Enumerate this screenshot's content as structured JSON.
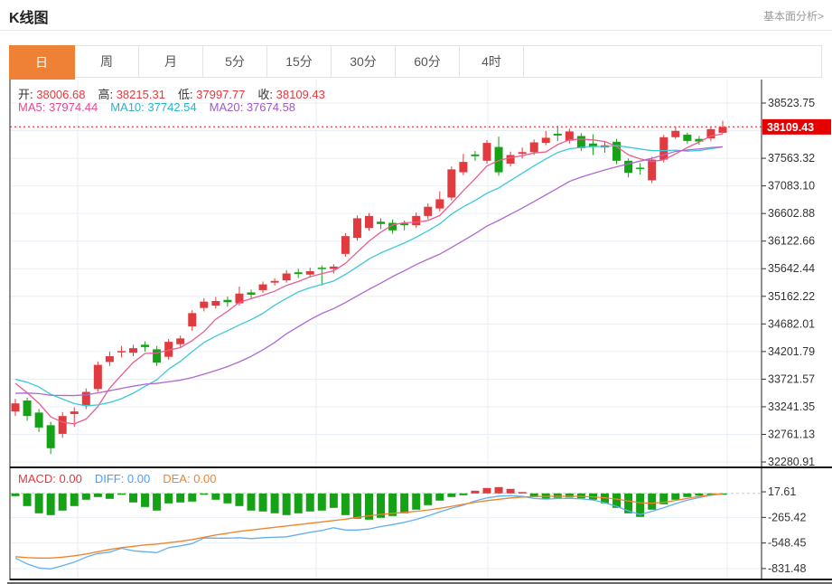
{
  "header": {
    "title": "K线图",
    "link": "基本面分析>"
  },
  "tabs": {
    "items": [
      {
        "label": "日",
        "active": true
      },
      {
        "label": "周",
        "active": false
      },
      {
        "label": "月",
        "active": false
      },
      {
        "label": "5分",
        "active": false
      },
      {
        "label": "15分",
        "active": false
      },
      {
        "label": "30分",
        "active": false
      },
      {
        "label": "60分",
        "active": false
      },
      {
        "label": "4时",
        "active": false
      }
    ]
  },
  "legend": {
    "ohlc": [
      {
        "label": "开:",
        "value": "38006.68"
      },
      {
        "label": "高:",
        "value": "38215.31"
      },
      {
        "label": "低:",
        "value": "37997.77"
      },
      {
        "label": "收:",
        "value": "38109.43"
      }
    ],
    "ma": [
      {
        "label": "MA5:",
        "value": "37974.44",
        "color": "#e8478f"
      },
      {
        "label": "MA10:",
        "value": "37742.54",
        "color": "#29b5c8"
      },
      {
        "label": "MA20:",
        "value": "37674.58",
        "color": "#a159c9"
      }
    ],
    "macd": [
      {
        "label": "MACD:",
        "value": "0.00",
        "color": "#e5383d"
      },
      {
        "label": "DIFF:",
        "value": "0.00",
        "color": "#4a9ff0"
      },
      {
        "label": "DEA:",
        "value": "0.00",
        "color": "#ef8330"
      }
    ]
  },
  "colors": {
    "up": "#e23b3f",
    "down": "#16a216",
    "ma5": "#ea5d8f",
    "ma10": "#3cc8dc",
    "ma20": "#b168cf",
    "diff": "#64aff0",
    "dea": "#f0842c",
    "badge": "#e60000",
    "tab_accent": "#ee8136",
    "price_line": "#f44f4f",
    "grid": "#e9eef6",
    "zero_dash": "#a4d6f0"
  },
  "chart_data": {
    "type": "candlestick",
    "title": "K线图",
    "legend_position": "top-left",
    "grid": true,
    "price_axis": {
      "top_tick": 38523.75,
      "tick_step": 480.215,
      "num_intervals": 13,
      "ticks": [
        "38523.75",
        "37563.32",
        "37083.10",
        "36602.88",
        "36122.66",
        "35642.44",
        "35162.22",
        "34682.01",
        "34201.79",
        "33721.57",
        "33241.35",
        "32761.13",
        "32280.91"
      ],
      "last_price": "38109.43",
      "last_price_value": 38109.43
    },
    "ohlc_today": {
      "open": 38006.68,
      "high": 38215.31,
      "low": 37997.77,
      "close": 38109.43
    },
    "ma_values": {
      "MA5": 37974.44,
      "MA10": 37742.54,
      "MA20": 37674.58
    },
    "candles": [
      [
        33160,
        33380,
        33080,
        33300
      ],
      [
        33350,
        33400,
        33000,
        33080
      ],
      [
        33140,
        33200,
        32800,
        32880
      ],
      [
        32920,
        32980,
        32420,
        32520
      ],
      [
        32770,
        33150,
        32700,
        33080
      ],
      [
        33115,
        33230,
        32890,
        33160
      ],
      [
        33270,
        33560,
        33200,
        33500
      ],
      [
        33550,
        34030,
        33500,
        33970
      ],
      [
        34020,
        34200,
        33950,
        34120
      ],
      [
        34200,
        34300,
        34100,
        34210
      ],
      [
        34180,
        34320,
        34120,
        34260
      ],
      [
        34320,
        34380,
        34200,
        34280
      ],
      [
        34240,
        34300,
        33950,
        34010
      ],
      [
        34110,
        34420,
        34060,
        34370
      ],
      [
        34330,
        34480,
        34280,
        34430
      ],
      [
        34640,
        34920,
        34560,
        34870
      ],
      [
        34960,
        35130,
        34900,
        35070
      ],
      [
        35000,
        35150,
        34950,
        35080
      ],
      [
        35100,
        35160,
        34980,
        35060
      ],
      [
        35040,
        35330,
        35000,
        35210
      ],
      [
        35230,
        35280,
        35120,
        35190
      ],
      [
        35270,
        35420,
        35220,
        35370
      ],
      [
        35400,
        35480,
        35350,
        35430
      ],
      [
        35440,
        35620,
        35400,
        35560
      ],
      [
        35580,
        35640,
        35480,
        35550
      ],
      [
        35540,
        35660,
        35490,
        35600
      ],
      [
        35660,
        35700,
        35350,
        35640
      ],
      [
        35640,
        35720,
        35560,
        35680
      ],
      [
        35900,
        36260,
        35850,
        36210
      ],
      [
        36180,
        36570,
        36130,
        36520
      ],
      [
        36350,
        36610,
        36300,
        36560
      ],
      [
        36460,
        36520,
        36330,
        36420
      ],
      [
        36440,
        36500,
        36250,
        36310
      ],
      [
        36430,
        36480,
        36310,
        36400
      ],
      [
        36400,
        36620,
        36350,
        36560
      ],
      [
        36560,
        36780,
        36500,
        36720
      ],
      [
        36690,
        36990,
        36640,
        36850
      ],
      [
        36880,
        37420,
        36830,
        37370
      ],
      [
        37320,
        37640,
        37270,
        37500
      ],
      [
        37630,
        37690,
        37520,
        37600
      ],
      [
        37520,
        37880,
        37470,
        37830
      ],
      [
        37760,
        37940,
        37260,
        37320
      ],
      [
        37470,
        37680,
        37420,
        37620
      ],
      [
        37640,
        37750,
        37560,
        37670
      ],
      [
        37670,
        37890,
        37620,
        37840
      ],
      [
        37830,
        38040,
        37790,
        37920
      ],
      [
        37990,
        38130,
        37860,
        37960
      ],
      [
        37870,
        38080,
        37820,
        38030
      ],
      [
        37950,
        38000,
        37690,
        37740
      ],
      [
        37820,
        37980,
        37620,
        37760
      ],
      [
        37750,
        37850,
        37660,
        37790
      ],
      [
        37850,
        37900,
        37460,
        37520
      ],
      [
        37520,
        37560,
        37230,
        37310
      ],
      [
        37400,
        37480,
        37280,
        37380
      ],
      [
        37180,
        37590,
        37130,
        37540
      ],
      [
        37540,
        37970,
        37490,
        37930
      ],
      [
        37930,
        38120,
        37900,
        38040
      ],
      [
        37975,
        38010,
        37820,
        37865
      ],
      [
        37900,
        37950,
        37800,
        37855
      ],
      [
        37910,
        38110,
        37860,
        38070
      ],
      [
        38006.68,
        38215.31,
        37997.77,
        38109.43
      ]
    ],
    "ma_windows": [
      5,
      10,
      20
    ],
    "ma_seed_closes": [
      33000,
      33050,
      33100,
      33150,
      33200,
      33250,
      33300,
      33350,
      33400,
      33500,
      33600,
      33700,
      33800,
      33900,
      33950,
      33900,
      33800,
      33700,
      33550
    ],
    "macd": {
      "ticks": [
        "17.61",
        "-265.42",
        "-548.45",
        "-831.48"
      ],
      "hist": [
        -30,
        -140,
        -220,
        -240,
        -190,
        -140,
        -70,
        -40,
        -60,
        -15,
        -100,
        -150,
        -190,
        -110,
        -100,
        -90,
        -15,
        -70,
        -110,
        -140,
        -190,
        -200,
        -220,
        -240,
        -220,
        -200,
        -190,
        -160,
        -240,
        -280,
        -290,
        -270,
        -250,
        -220,
        -180,
        -130,
        -80,
        -40,
        -20,
        30,
        60,
        70,
        50,
        15,
        -40,
        -60,
        -50,
        -45,
        -55,
        -70,
        -110,
        -160,
        -220,
        -260,
        -180,
        -120,
        -70,
        -40,
        -25,
        -12,
        -5
      ],
      "dea": [
        -700,
        -710,
        -715,
        -715,
        -705,
        -690,
        -670,
        -645,
        -620,
        -600,
        -585,
        -570,
        -560,
        -545,
        -530,
        -510,
        -485,
        -460,
        -440,
        -420,
        -405,
        -390,
        -375,
        -360,
        -345,
        -330,
        -315,
        -300,
        -285,
        -265,
        -248,
        -232,
        -220,
        -210,
        -198,
        -183,
        -165,
        -143,
        -120,
        -98,
        -80,
        -65,
        -50,
        -40,
        -35,
        -33,
        -32,
        -32,
        -33,
        -38,
        -48,
        -63,
        -83,
        -103,
        -108,
        -98,
        -78,
        -55,
        -33,
        -15,
        -2
      ],
      "diff": [
        -715,
        -780,
        -825,
        -835,
        -800,
        -760,
        -705,
        -665,
        -650,
        -607.5,
        -635,
        -645,
        -655,
        -600,
        -580,
        -555,
        -492.5,
        -495,
        -495,
        -490,
        -500,
        -490,
        -485,
        -480,
        -455,
        -430,
        -410,
        -380,
        -405,
        -405,
        -393,
        -367,
        -345,
        -320,
        -288,
        -248,
        -205,
        -163,
        -130,
        -83,
        -50,
        -30,
        -25,
        -32.5,
        -55,
        -63,
        -57,
        -54.5,
        -60.5,
        -73,
        -103,
        -143,
        -193,
        -233,
        -198,
        -158,
        -113,
        -75,
        -45.5,
        -21,
        -4.5
      ]
    }
  }
}
